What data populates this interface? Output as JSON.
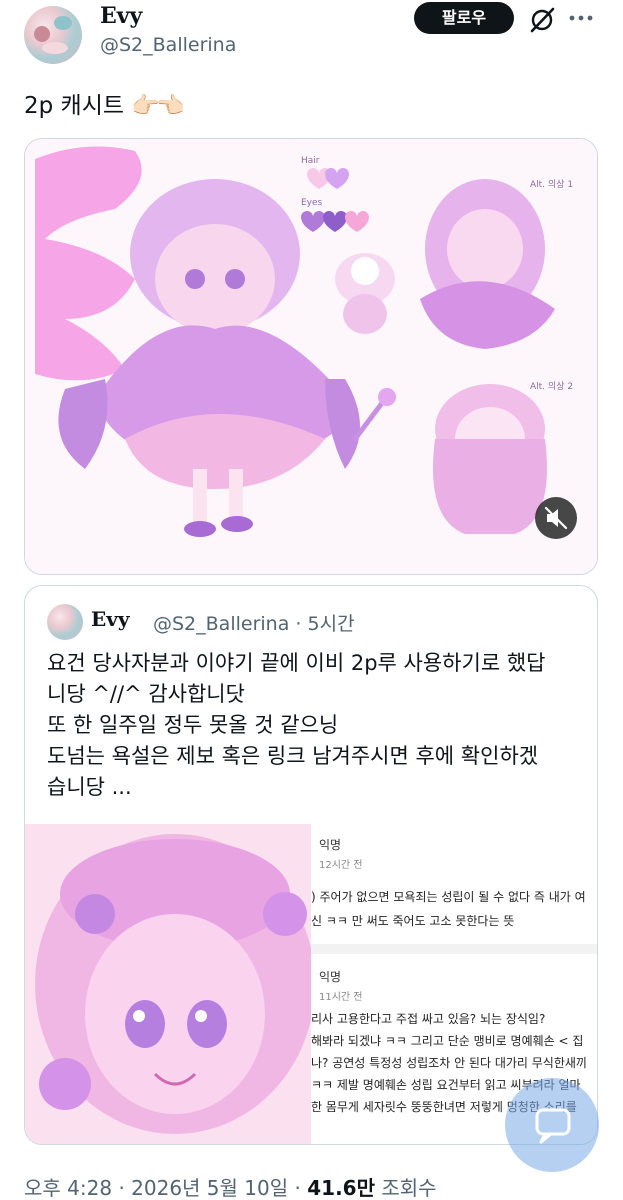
{
  "author": {
    "display_name": "Evy",
    "handle": "@S2_Ballerina",
    "follow_label": "팔로우"
  },
  "tweet": {
    "text": "2p 캐시트",
    "emoji": "👉🏻👈🏻"
  },
  "media": {
    "sheet_notes": {
      "hair": "Hair",
      "eyes": "Eyes",
      "alt1": "Alt. 의상 1",
      "alt2": "Alt. 의상 2"
    }
  },
  "quote": {
    "display_name": "Evy",
    "handle": "@S2_Ballerina",
    "time": "5시간",
    "lines": [
      "요건 당사자분과 이야기 끝에 이비 2p루 사용하기로 했답",
      "니당 ^//^ 감사합니닷",
      "또 한 일주일 정두 못올 것 같으닝",
      "도넘는 욕설은 제보 혹은 링크 남겨주시면 후에 확인하겠",
      "습니당 ..."
    ],
    "comments": [
      {
        "user": "익명",
        "time": "12시간 전",
        "lines": [
          ") 주어가 없으면 모욕죄는 성립이 될 수 없다 즉 내가 여",
          "신 ㅋㅋ 만 써도 죽어도 고소 못한다는 뜻"
        ]
      },
      {
        "user": "익명",
        "time": "11시간 전",
        "lines": [
          "리사 고용한다고 주접 싸고 있음? 뇌는 장식임?",
          "해봐라 되겠냐 ㅋㅋ 그리고 단순 맹비로 명예훼손 < 집",
          "나? 공연성 특정성 성립조차 안 된다 대가리 무식한새끼",
          "ㅋㅋ 제발 명예훼손 성립 요건부터 읽고 씨부려라 얼마",
          "한 몸무게 세자릿수 뚱뚱한녀면 저렇게 멍청한 소리를"
        ]
      }
    ]
  },
  "footer": {
    "time": "오후 4:28",
    "date": "2026년 5월 10일",
    "views_count": "41.6만",
    "views_label": "조회수"
  },
  "colors": {
    "text": "#0f1419",
    "secondary": "#536471",
    "border": "#cfd9de",
    "accent_pink": "#f5a0e6",
    "accent_purple": "#c89be8"
  }
}
